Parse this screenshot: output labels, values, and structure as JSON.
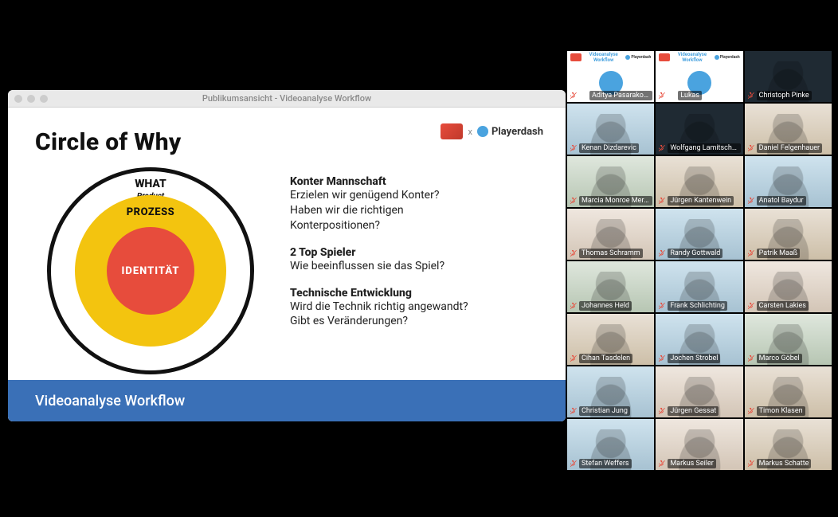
{
  "window": {
    "title": "Publikumsansicht - Videoanalyse Workflow"
  },
  "slide": {
    "title": "Circle of Why",
    "logo_partner": "Playerdash",
    "circle": {
      "outer_label": "WHAT",
      "outer_sub": "Product",
      "middle_label": "PROZESS",
      "inner_label": "IDENTITÄT"
    },
    "sections": [
      {
        "heading": "Konter Mannschaft",
        "lines": [
          "Erzielen wir genügend Konter?",
          "Haben wir die richtigen",
          "Konterpositionen?"
        ]
      },
      {
        "heading": "2 Top Spieler",
        "lines": [
          "Wie beeinflussen sie das Spiel?"
        ]
      },
      {
        "heading": "Technische Entwicklung",
        "lines": [
          "Wird die Technik richtig angewandt?",
          "Gibt es Veränderungen?"
        ]
      }
    ],
    "footer": "Videoanalyse Workflow"
  },
  "participants": [
    {
      "name": "Aditya Pasarakonda -…",
      "muted": true,
      "pinned": true,
      "speaking": true,
      "bg": "bg-slide"
    },
    {
      "name": "Lukas",
      "muted": true,
      "pinned": true,
      "speaking": false,
      "bg": "bg-slide"
    },
    {
      "name": "Christoph Pinke",
      "muted": true,
      "pinned": false,
      "speaking": false,
      "bg": "bg-dark"
    },
    {
      "name": "Kenan Dizdarevic",
      "muted": true,
      "pinned": false,
      "speaking": false,
      "bg": "bg-room1"
    },
    {
      "name": "Wolfgang Lamitschka",
      "muted": true,
      "pinned": false,
      "speaking": false,
      "bg": "bg-dark"
    },
    {
      "name": "Daniel Felgenhauer",
      "muted": true,
      "pinned": false,
      "speaking": false,
      "bg": "bg-room2"
    },
    {
      "name": "Marcia Monroe Merc…",
      "muted": true,
      "pinned": false,
      "speaking": false,
      "bg": "bg-room3"
    },
    {
      "name": "Jürgen Kantenwein",
      "muted": true,
      "pinned": false,
      "speaking": false,
      "bg": "bg-room2"
    },
    {
      "name": "Anatol Baydur",
      "muted": true,
      "pinned": false,
      "speaking": false,
      "bg": "bg-room1"
    },
    {
      "name": "Thomas Schramm",
      "muted": true,
      "pinned": false,
      "speaking": false,
      "bg": "bg-room4"
    },
    {
      "name": "Randy Gottwald",
      "muted": true,
      "pinned": false,
      "speaking": false,
      "bg": "bg-room1"
    },
    {
      "name": "Patrik Maaß",
      "muted": true,
      "pinned": false,
      "speaking": false,
      "bg": "bg-room2"
    },
    {
      "name": "Johannes Held",
      "muted": true,
      "pinned": false,
      "speaking": false,
      "bg": "bg-room3"
    },
    {
      "name": "Frank Schlichting",
      "muted": true,
      "pinned": false,
      "speaking": false,
      "bg": "bg-room1"
    },
    {
      "name": "Carsten Lakies",
      "muted": true,
      "pinned": false,
      "speaking": false,
      "bg": "bg-room4"
    },
    {
      "name": "Cihan Tasdelen",
      "muted": true,
      "pinned": false,
      "speaking": false,
      "bg": "bg-room2"
    },
    {
      "name": "Jochen Strobel",
      "muted": true,
      "pinned": false,
      "speaking": false,
      "bg": "bg-room1"
    },
    {
      "name": "Marco Göbel",
      "muted": true,
      "pinned": false,
      "speaking": false,
      "bg": "bg-room3"
    },
    {
      "name": "Christian Jung",
      "muted": true,
      "pinned": false,
      "speaking": false,
      "bg": "bg-room1"
    },
    {
      "name": "Jürgen Gessat",
      "muted": true,
      "pinned": false,
      "speaking": false,
      "bg": "bg-room4"
    },
    {
      "name": "Timon Klasen",
      "muted": true,
      "pinned": false,
      "speaking": false,
      "bg": "bg-room2"
    },
    {
      "name": "Stefan Weffers",
      "muted": true,
      "pinned": false,
      "speaking": false,
      "bg": "bg-room1"
    },
    {
      "name": "Markus Seiler",
      "muted": true,
      "pinned": false,
      "speaking": false,
      "bg": "bg-room4"
    },
    {
      "name": "Markus Schatte",
      "muted": true,
      "pinned": false,
      "speaking": false,
      "bg": "bg-room2"
    }
  ]
}
